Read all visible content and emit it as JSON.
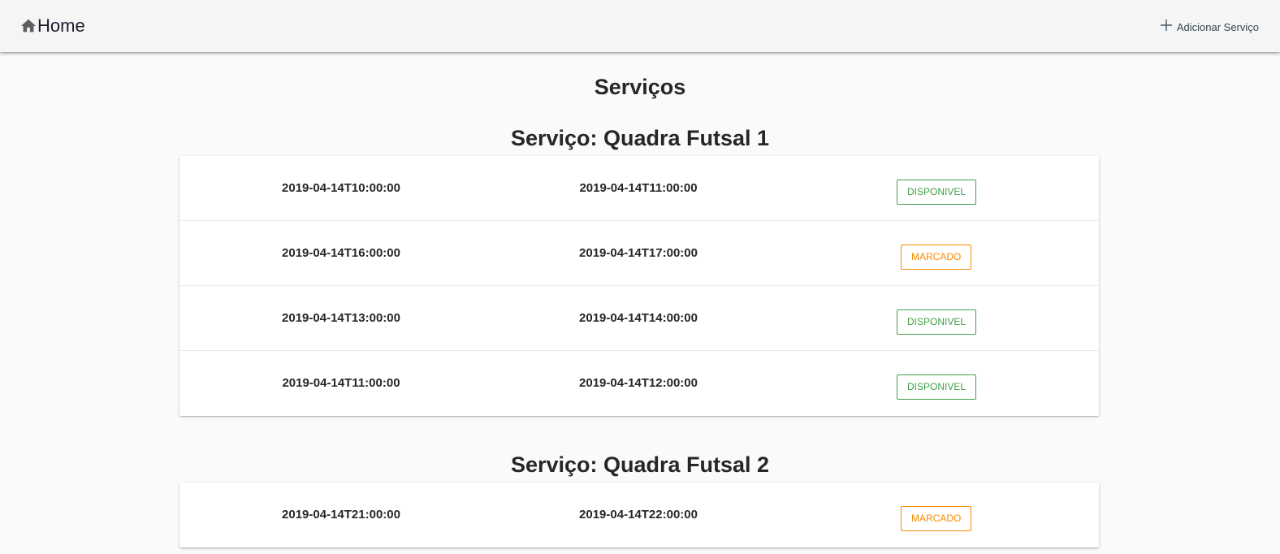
{
  "header": {
    "home_label": "Home",
    "add_service_label": "Adicionar Serviço"
  },
  "page_title": "Serviços",
  "services": [
    {
      "title": "Serviço: Quadra Futsal 1",
      "slots": [
        {
          "start": "2019-04-14T10:00:00",
          "end": "2019-04-14T11:00:00",
          "status": "DISPONIVEL"
        },
        {
          "start": "2019-04-14T16:00:00",
          "end": "2019-04-14T17:00:00",
          "status": "MARCADO"
        },
        {
          "start": "2019-04-14T13:00:00",
          "end": "2019-04-14T14:00:00",
          "status": "DISPONIVEL"
        },
        {
          "start": "2019-04-14T11:00:00",
          "end": "2019-04-14T12:00:00",
          "status": "DISPONIVEL"
        }
      ]
    },
    {
      "title": "Serviço: Quadra Futsal 2",
      "slots": [
        {
          "start": "2019-04-14T21:00:00",
          "end": "2019-04-14T22:00:00",
          "status": "MARCADO"
        }
      ]
    }
  ],
  "colors": {
    "available": "#43a047",
    "booked": "#fb8c00",
    "topbar": "#f5f5f5"
  }
}
